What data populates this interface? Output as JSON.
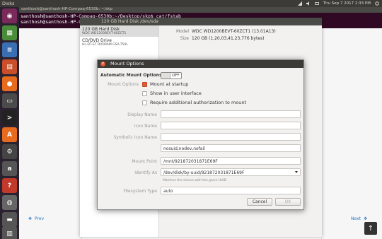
{
  "topbar": {
    "app_title": "Disks",
    "datetime": "Thu Sep 7 2017 2:33 PM"
  },
  "terminal": {
    "title": "santhosh@santhosh-HP-Compaq-6530b: ~/skp",
    "lines": [
      "santhosh@santhosh-HP-Compaq-6530b:~/Desktop/skp$ cat/fstab",
      "santhosh@santhosh-HP-Compaq-6530b:~/Desktop/skp$"
    ]
  },
  "disks": {
    "title": "120 GB Hard Disk   /dev/sda",
    "items": [
      {
        "name": "120 GB Hard Disk",
        "sub": "WDC WD1200BEVT-60ZCT1"
      },
      {
        "name": "CD/DVD Drive",
        "sub": "HL-DT-ST DVDRAM GSA-T50L"
      }
    ],
    "props": [
      {
        "k": "Model",
        "v": "WDC WD1200BEVT-60ZCT1 (13.01A13)"
      },
      {
        "k": "Size",
        "v": "120 GB (1,20,03,41,23,776 bytes)"
      }
    ]
  },
  "dialog": {
    "title": "Mount Options",
    "auto_label": "Automatic Mount Options",
    "auto_state": "OFF",
    "mount_options_label": "Mount Options",
    "mount_at_startup": "Mount at startup",
    "show_in_ui": "Show in user interface",
    "require_auth": "Require additional authorization to mount",
    "display_name_label": "Display Name",
    "display_name_value": "",
    "icon_name_label": "Icon Name",
    "icon_name_value": "",
    "symbolic_icon_label": "Symbolic Icon Name",
    "symbolic_icon_value": "",
    "options_value": "nosuid,nodev,nofail",
    "mount_point_label": "Mount Point",
    "mount_point_value": "/mnt/921872031871E69F",
    "identify_as_label": "Identify As",
    "identify_as_value": "/dev/disk/by-uuid/921872031871E69F",
    "identify_hint": "Matches the device with the given UUID",
    "fs_type_label": "Filesystem Type",
    "fs_type_value": "auto",
    "cancel": "Cancel",
    "ok": "OK"
  },
  "page": {
    "prev": "Prev",
    "next": "Next"
  },
  "colors": {
    "accent": "#e05a33",
    "link": "#2a76c6"
  }
}
